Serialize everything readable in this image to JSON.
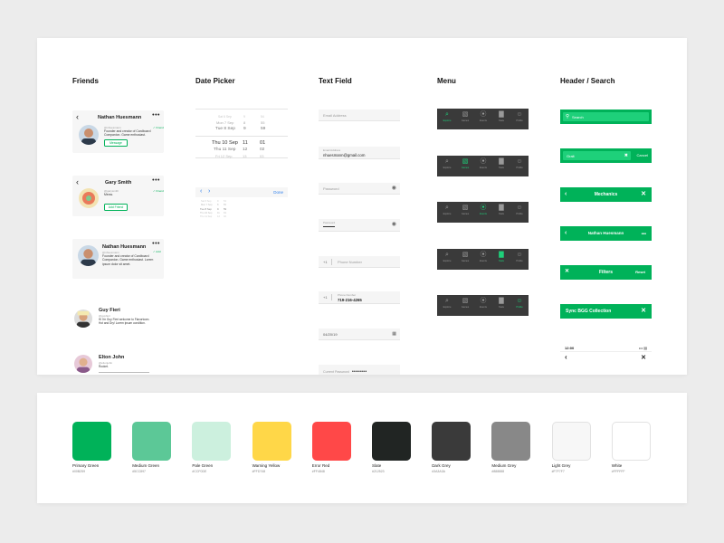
{
  "sections": {
    "friends": "Friends",
    "date_picker": "Date Picker",
    "text_field": "Text Field",
    "menu": "Menu",
    "header_search": "Header / Search"
  },
  "friends": {
    "card1": {
      "name": "Nathan Huesmann",
      "handle": "@nhuesmann",
      "badge": "✓ Friend",
      "bio": "Founder and creator of Cardboard Companion. Game enthusiast.",
      "button": "Message"
    },
    "card2": {
      "name": "Gary Smith",
      "handle": "@garysmith",
      "badge": "✓ Friend",
      "bio": "Meow.",
      "button": "Add Friend"
    },
    "card3": {
      "name": "Nathan Huesmann",
      "handle": "@nhuesmann",
      "badge": "✓ Add",
      "bio": "Founder and creator of Cardboard Companion. Game enthusiast. Lorem ipsum dolor sit amet."
    },
    "item4": {
      "name": "Guy Fieri",
      "handle": "@guyfieri",
      "bio": "Hi I'm Guy Fieri welcome to Flavortown. Hot and Dry! Lorem ipsum condition."
    },
    "item5": {
      "name": "Elton John",
      "handle": "@eltonjohn",
      "bio": "Rocket."
    }
  },
  "date_picker": {
    "wheel_rows": [
      {
        "date": "Sat 6 Sep",
        "h": "9",
        "m": "54"
      },
      {
        "date": "Mon 7 Sep",
        "h": "8",
        "m": "55"
      },
      {
        "date": "Tue 8 Sep",
        "h": "9",
        "m": "59"
      },
      {
        "date": "Thu 10 Sep",
        "h": "11",
        "m": "01"
      },
      {
        "date": "Thu 11 Sep",
        "h": "12",
        "m": "02"
      },
      {
        "date": "Fri 12 Sep",
        "h": "13",
        "m": "03"
      }
    ],
    "done": "Done"
  },
  "text_fields": {
    "email_placeholder": "Email Address",
    "email_label": "Email Address",
    "email_value": "nhuesmann@gmail.com",
    "password_placeholder": "Password",
    "password_label": "Password",
    "phone_prefix": "+1",
    "phone_placeholder": "Phone Number",
    "phone_label": "Phone Number",
    "phone_value": "719-216-4265",
    "date_value": "04/20/19",
    "current_password_label": "Current Password",
    "current_password_value": "••••••••"
  },
  "menu": {
    "items": [
      "Explore",
      "Games",
      "Events",
      "Stats",
      "Profile"
    ],
    "glyphs": [
      "⌕",
      "▧",
      "⦿",
      "▇",
      "☺"
    ]
  },
  "header": {
    "search_placeholder": "Search",
    "search_value": "Gralt",
    "cancel": "Cancel",
    "mechanics": "Mechanics",
    "profile_name": "Nathan Huesmann",
    "filters": "Filters",
    "reset": "Reset",
    "sync": "Sync BGG Collection",
    "status_time": "12:00",
    "status_icons": "••• ▤"
  },
  "colors": [
    {
      "name": "Primary Green",
      "hex": "#00B259",
      "value": "#00b259"
    },
    {
      "name": "Medium Green",
      "hex": "#5CC897",
      "value": "#5cc897"
    },
    {
      "name": "Pale Green",
      "hex": "#CCF0DE",
      "value": "#ccf0de"
    },
    {
      "name": "Warning Yellow",
      "hex": "#FFD748",
      "value": "#ffd748"
    },
    {
      "name": "Error Red",
      "hex": "#FF4848",
      "value": "#ff4848"
    },
    {
      "name": "Slate",
      "hex": "#212523",
      "value": "#212523"
    },
    {
      "name": "Dark Grey",
      "hex": "#3A3A3A",
      "value": "#3a3a3a"
    },
    {
      "name": "Medium Grey",
      "hex": "#888888",
      "value": "#888888"
    },
    {
      "name": "Light Grey",
      "hex": "#F7F7F7",
      "value": "#f7f7f7"
    },
    {
      "name": "White",
      "hex": "#FFFFFF",
      "value": "#ffffff"
    }
  ]
}
